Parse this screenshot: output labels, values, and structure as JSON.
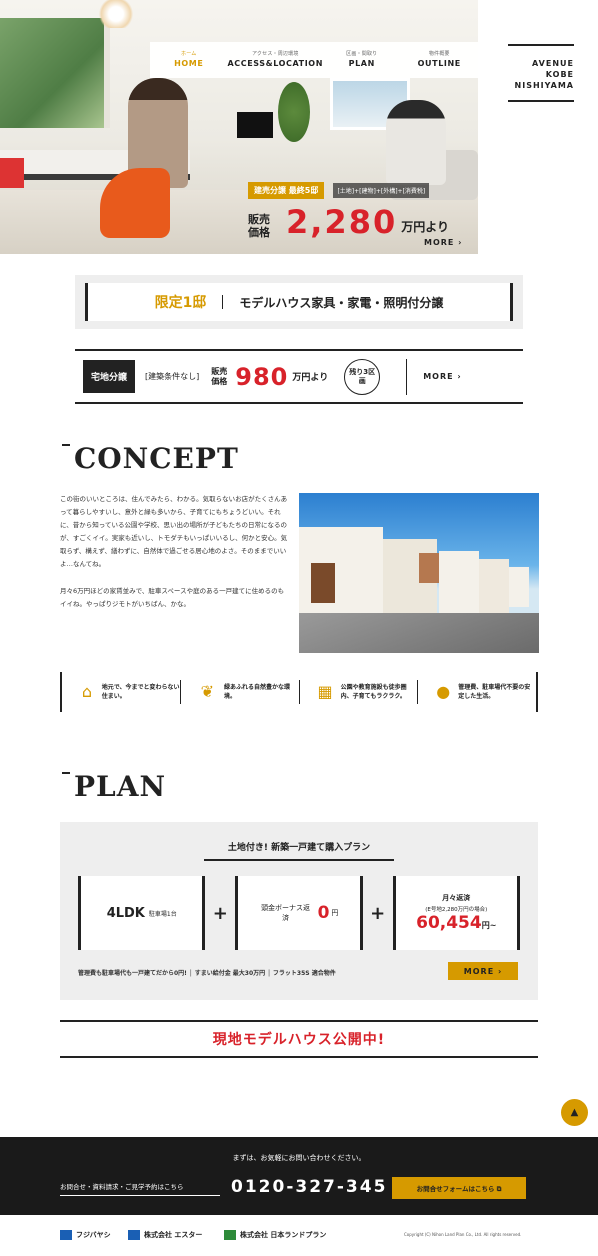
{
  "nav": [
    {
      "sub": "ホーム",
      "label": "HOME"
    },
    {
      "sub": "アクセス・周辺環境",
      "label": "ACCESS&LOCATION"
    },
    {
      "sub": "区画・間取り",
      "label": "PLAN"
    },
    {
      "sub": "物件概要",
      "label": "OUTLINE"
    }
  ],
  "logo": {
    "line1": "AVENUE",
    "line2": "KOBE",
    "line3": "NISHIYAMA"
  },
  "hero": {
    "tag": "建売分譲 最終5邸",
    "extra": "[土地]+[建物]+[外構]+[消費税]",
    "price_label": "販売価格",
    "price": "2,280",
    "price_unit": "万円より",
    "more": "MORE ›"
  },
  "limited": {
    "accent": "限定1邸",
    "text": "モデルハウス家具・家電・照明付分譲"
  },
  "lot": {
    "tag": "宅地分譲",
    "condition": "[建築条件なし]",
    "price_label": "販売価格",
    "price": "980",
    "unit": "万円より",
    "remain": "残り3区画",
    "more": "MORE ›"
  },
  "concept": {
    "title": "CONCEPT",
    "para1": "この街のいいところは、住んでみたら、わかる。気取らないお店がたくさんあって暮らしやすいし、意外と緑も多いから、子育てにもちょうどいい。それに、昔から知っている公園や学校、思い出の場所が子どもたちの日常になるのが、すごくイイ。実家も近いし、トモダチもいっぱいいるし、何かと安心。気取らず、構えず、繕わずに、自然体で過ごせる居心地のよさ。そのままでいいよ…なんてね。",
    "para2": "月々6万円ほどの家賃並みで、駐車スペースや庭のある一戸建てに住めるのもイイね。やっぱりジモトがいちばん、かな。",
    "features": [
      {
        "icon": "house-icon",
        "text": "地元で、今までと変わらない住まい。"
      },
      {
        "icon": "leaf-icon",
        "text": "緑あふれる自然豊かな環境。"
      },
      {
        "icon": "building-icon",
        "text": "公園や教育施設も徒歩圏内、子育てもラクラク。"
      },
      {
        "icon": "person-icon",
        "text": "管理費、駐車場代不要の安定した生活。"
      }
    ]
  },
  "plan": {
    "title": "PLAN",
    "heading": "土地付き! 新築一戸建て購入プラン",
    "card1_big": "4LDK",
    "card1_small": "駐車場1台",
    "card2_label": "頭金ボーナス返済",
    "card2_num": "0",
    "card2_unit": "円",
    "card3_label": "月々返済",
    "card3_sub": "(E号地2,280万円の場合)",
    "card3_num": "60,454",
    "card3_unit": "円~",
    "footnote": "管理費も駐車場代も一戸建てだから0円! │ すまい給付金 最大30万円 │ フラット35S 適合物件",
    "more": "MORE ›"
  },
  "model_house": "現地モデルハウス公開中!",
  "cta": {
    "lead": "まずは、お気軽にお問い合わせください。",
    "label": "お問合せ・資料請求・ご見学予約はこちら",
    "tel": "0120-327-345",
    "button": "お問合せフォームはこちら ⧉"
  },
  "companies": [
    "フジバヤシ",
    "株式会社 エスター",
    "株式会社 日本ランドプラン"
  ],
  "copyright": "Copyright (C) Nihon Land Plan Co., Ltd. All rights reserved."
}
